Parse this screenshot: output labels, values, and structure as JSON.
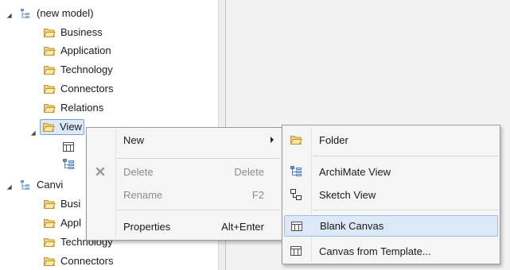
{
  "tree": {
    "items": [
      {
        "label": "(new model)",
        "icon": "model-icon",
        "expanded": true
      },
      {
        "label": "Business",
        "icon": "folder-icon"
      },
      {
        "label": "Application",
        "icon": "folder-icon"
      },
      {
        "label": "Technology",
        "icon": "folder-icon"
      },
      {
        "label": "Connectors",
        "icon": "folder-icon"
      },
      {
        "label": "Relations",
        "icon": "folder-icon"
      },
      {
        "label": "View",
        "icon": "folder-icon",
        "expanded": true,
        "selected": true
      },
      {
        "label": "Canvi",
        "icon": "model-icon",
        "expanded": true
      },
      {
        "label": "Busi",
        "icon": "folder-icon"
      },
      {
        "label": "Appl",
        "icon": "folder-icon"
      },
      {
        "label": "Technology",
        "icon": "folder-icon"
      },
      {
        "label": "Connectors",
        "icon": "folder-icon"
      }
    ]
  },
  "context_menu": {
    "items": [
      {
        "label": "New",
        "accelerator": "",
        "enabled": true,
        "submenu": true
      },
      {
        "label": "Delete",
        "accelerator": "Delete",
        "enabled": false,
        "icon": "delete-x-icon"
      },
      {
        "label": "Rename",
        "accelerator": "F2",
        "enabled": false
      },
      {
        "label": "Properties",
        "accelerator": "Alt+Enter",
        "enabled": true
      }
    ]
  },
  "submenu": {
    "items": [
      {
        "label": "Folder",
        "icon": "folder-icon"
      },
      {
        "label": "ArchiMate View",
        "icon": "archimate-view-icon"
      },
      {
        "label": "Sketch View",
        "icon": "sketch-view-icon"
      },
      {
        "label": "Blank Canvas",
        "icon": "canvas-icon",
        "highlighted": true
      },
      {
        "label": "Canvas from Template...",
        "icon": "canvas-icon"
      }
    ]
  },
  "colors": {
    "folder_fill": "#f7d77a",
    "folder_stroke": "#c79a2a",
    "selection_fill": "#dbe9fa",
    "selection_border": "#7da2ce"
  }
}
